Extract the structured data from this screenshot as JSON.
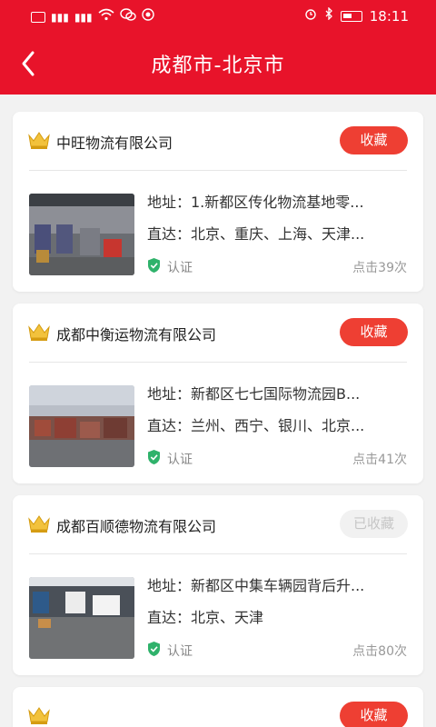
{
  "status": {
    "left_icons": [
      "hd-icon",
      "signal-4g-icon",
      "signal-4g-icon",
      "wifi-icon",
      "wechat-icon",
      "app-icon"
    ],
    "time": "18:11"
  },
  "header": {
    "title": "成都市-北京市"
  },
  "colors": {
    "brand": "#e8132a",
    "fav_button": "#ee3f33",
    "verify_green": "#2fb26b"
  },
  "cards": [
    {
      "company": "中旺物流有限公司",
      "fav_label": "收藏",
      "address": "地址：1.新都区传化物流基地零...",
      "direct": "直达：北京、重庆、上海、天津...",
      "verify": "认证",
      "clicks": "点击39次"
    },
    {
      "company": "成都中衡运物流有限公司",
      "fav_label": "收藏",
      "address": "地址：新都区七七国际物流园B...",
      "direct": "直达：兰州、西宁、银川、北京...",
      "verify": "认证",
      "clicks": "点击41次"
    },
    {
      "company": "成都百顺德物流有限公司",
      "fav_label": "已收藏",
      "address": "地址：新都区中集车辆园背后升...",
      "direct": "直达：北京、天津",
      "verify": "认证",
      "clicks": "点击80次"
    },
    {
      "fav_label": "收藏"
    }
  ]
}
